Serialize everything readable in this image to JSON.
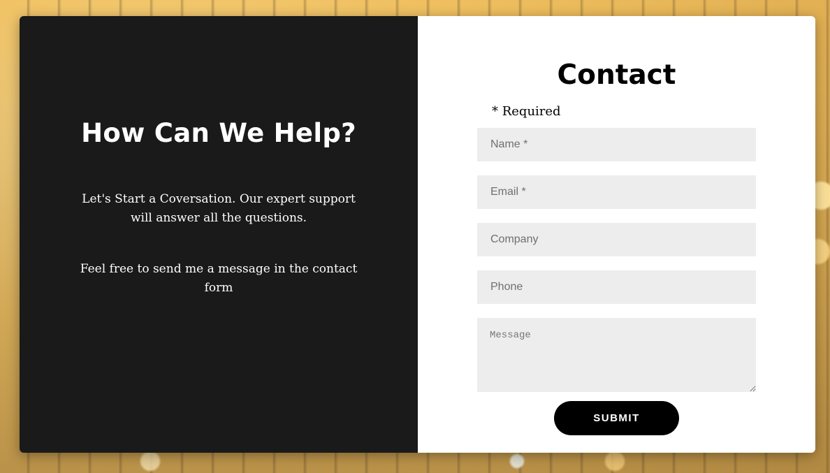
{
  "left": {
    "heading": "How Can We Help?",
    "paragraph1": "Let's Start a Coversation. Our expert support will answer all the questions.",
    "paragraph2": "Feel free to send me a message in the contact form"
  },
  "form": {
    "title": "Contact",
    "required_note": "* Required",
    "name_placeholder": "Name *",
    "email_placeholder": "Email *",
    "company_placeholder": "Company",
    "phone_placeholder": "Phone",
    "message_placeholder": "Message",
    "submit_label": "SUBMIT"
  },
  "colors": {
    "left_panel": "#1a1a1a",
    "input_bg": "#ededed",
    "button": "#000000"
  }
}
